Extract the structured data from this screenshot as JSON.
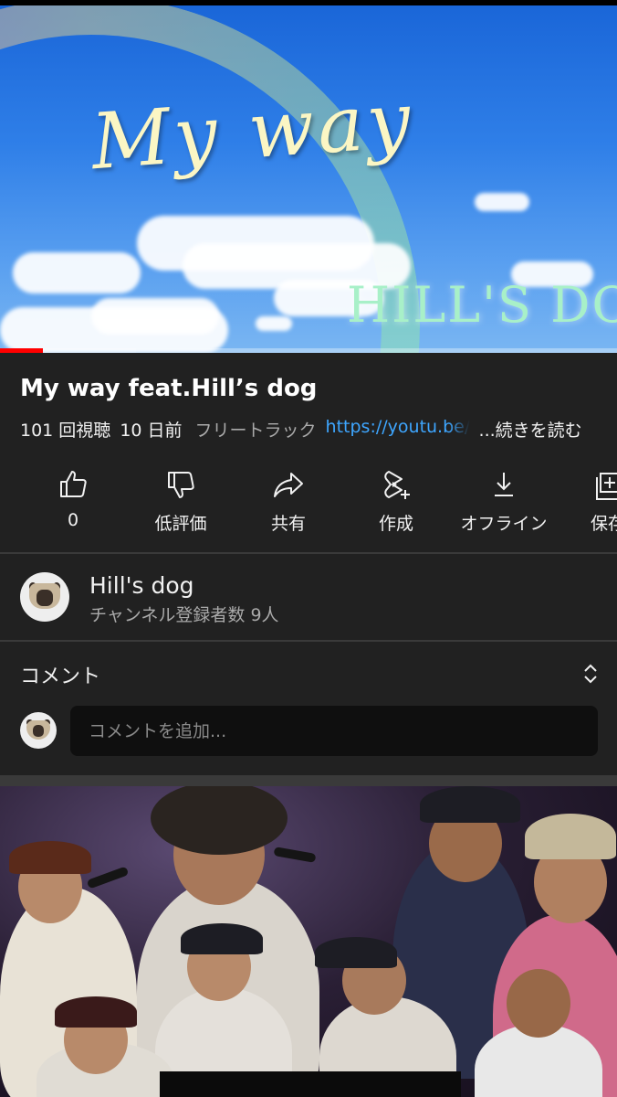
{
  "video": {
    "title_text": "My way",
    "brand_text": "HILL'S DOG",
    "progress_fraction": 0.07,
    "buffer_fraction": 0.22
  },
  "info": {
    "title": "My way feat.Hill’s dog",
    "views": "101 回視聴",
    "date": "10 日前",
    "tag": "フリートラック",
    "link": "https://youtu.be/",
    "more": "...続きを読む"
  },
  "actions": [
    {
      "label": "0",
      "icon": "thumbs-up-icon"
    },
    {
      "label": "低評価",
      "icon": "thumbs-down-icon"
    },
    {
      "label": "共有",
      "icon": "share-icon"
    },
    {
      "label": "作成",
      "icon": "create-icon"
    },
    {
      "label": "オフライン",
      "icon": "download-icon"
    },
    {
      "label": "保存",
      "icon": "save-icon"
    }
  ],
  "channel": {
    "name": "Hill's dog",
    "subscribers": "チャンネル登録者数 9人"
  },
  "comments": {
    "heading": "コメント",
    "placeholder": "コメントを追加..."
  },
  "colors": {
    "background": "#212121",
    "accent_red": "#ff0000",
    "link_blue": "#3ea6ff",
    "secondary_text": "#aaaaaa"
  }
}
